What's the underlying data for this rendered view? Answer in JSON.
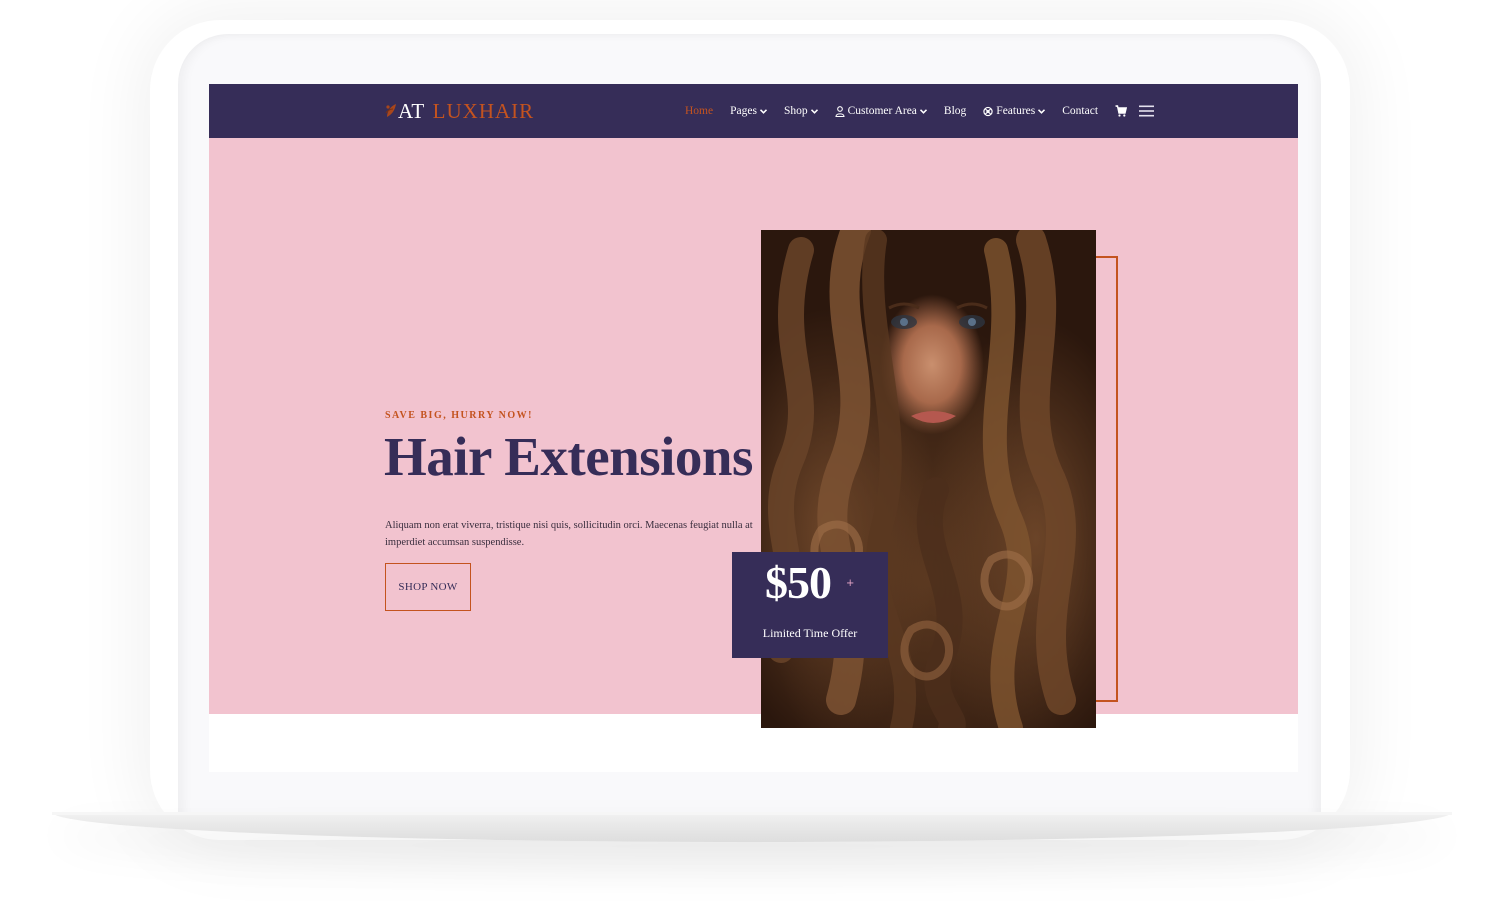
{
  "site": {
    "logo_prefix": "AT",
    "logo_name": "LUXHAIR"
  },
  "nav": {
    "items": [
      {
        "label": "Home",
        "active": true,
        "dropdown": false,
        "icon": null
      },
      {
        "label": "Pages",
        "active": false,
        "dropdown": true,
        "icon": null
      },
      {
        "label": "Shop",
        "active": false,
        "dropdown": true,
        "icon": null
      },
      {
        "label": "Customer Area",
        "active": false,
        "dropdown": true,
        "icon": "user-icon"
      },
      {
        "label": "Blog",
        "active": false,
        "dropdown": false,
        "icon": null
      },
      {
        "label": "Features",
        "active": false,
        "dropdown": true,
        "icon": "support-icon"
      },
      {
        "label": "Contact",
        "active": false,
        "dropdown": false,
        "icon": null
      }
    ],
    "cart_icon": "cart-icon",
    "menu_icon": "hamburger-menu-icon"
  },
  "hero": {
    "eyebrow": "SAVE BIG, HURRY NOW!",
    "title": "Hair Extensions",
    "description": "Aliquam non erat viverra, tristique nisi quis, sollicitudin orci. Maecenas feugiat nulla at imperdiet accumsan suspendisse.",
    "cta_label": "SHOP NOW",
    "price": "$50",
    "price_suffix": "+",
    "offer_label": "Limited Time Offer"
  },
  "colors": {
    "navbar": "#362d58",
    "accent": "#c4531f",
    "hero_bg": "#f2c3cf",
    "text_dark": "#362d58"
  }
}
